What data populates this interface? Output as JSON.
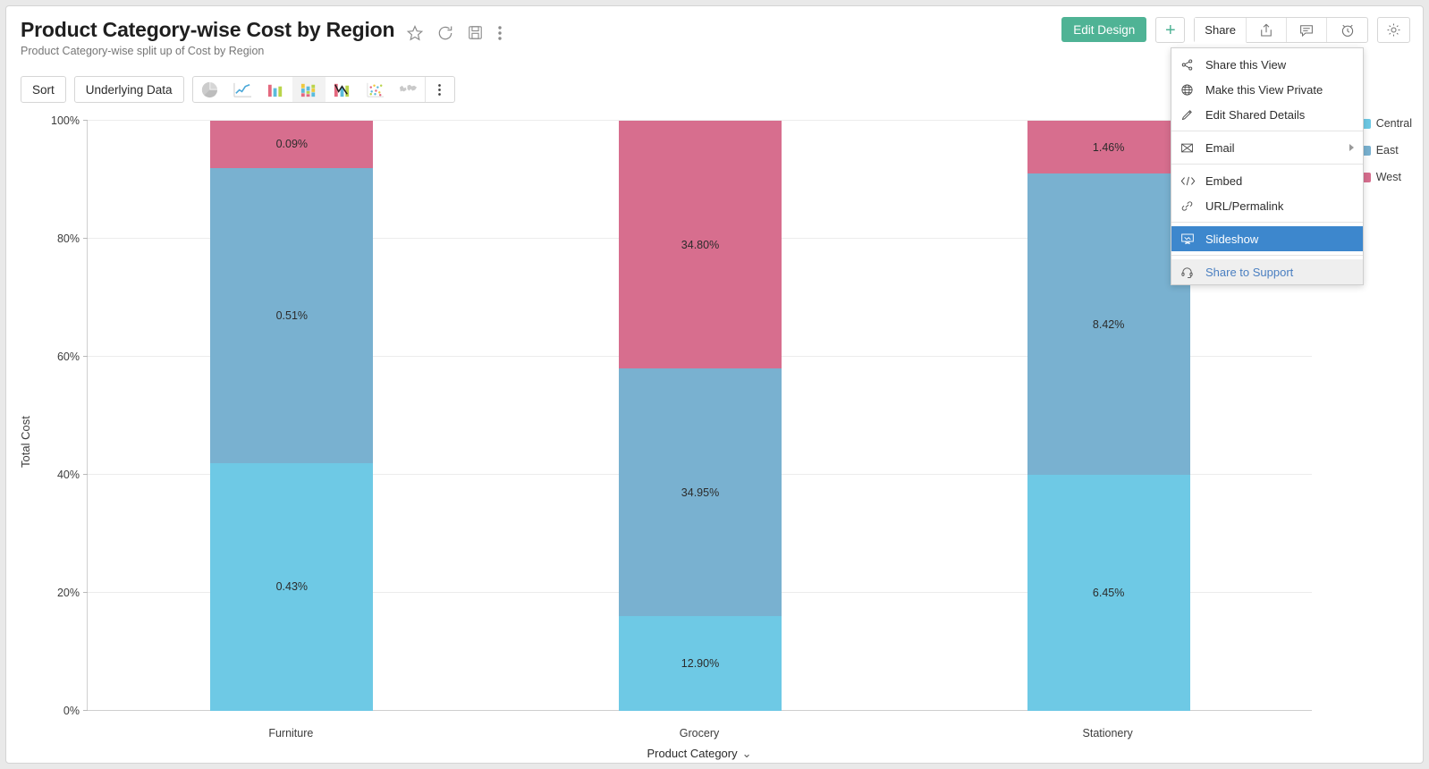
{
  "header": {
    "title": "Product Category-wise Cost by Region",
    "subtitle": "Product Category-wise split up of Cost by Region",
    "icons": [
      "favorite-star-icon",
      "refresh-icon",
      "save-icon",
      "more-options-icon"
    ]
  },
  "actions": {
    "edit_design_label": "Edit Design",
    "add_label": "+",
    "share_tab_label": "Share",
    "export_icon": "export-icon",
    "comment_icon": "comment-icon",
    "alarm_icon": "alarm-clock-icon",
    "settings_icon": "gear-icon",
    "accent_green": "#4fb395"
  },
  "share_menu": {
    "items": [
      {
        "label": "Share this View",
        "icon": "share-nodes-icon",
        "state": "normal"
      },
      {
        "label": "Make this View Private",
        "icon": "globe-icon",
        "state": "normal"
      },
      {
        "label": "Edit Shared Details",
        "icon": "pencil-icon",
        "state": "normal"
      },
      {
        "label": "Email",
        "icon": "envelope-icon",
        "state": "normal",
        "submenu": true
      },
      {
        "label": "Embed",
        "icon": "code-icon",
        "state": "normal"
      },
      {
        "label": "URL/Permalink",
        "icon": "link-icon",
        "state": "normal"
      },
      {
        "label": "Slideshow",
        "icon": "slideshow-icon",
        "state": "selected"
      },
      {
        "label": "Share to Support",
        "icon": "headset-icon",
        "state": "support"
      }
    ],
    "highlight_color": "#3d87cd"
  },
  "toolbar": {
    "sort_label": "Sort",
    "underlying_data_label": "Underlying Data",
    "chart_types": [
      {
        "name": "pie-chart-icon",
        "active": false,
        "disabled": true
      },
      {
        "name": "line-chart-icon",
        "active": false,
        "disabled": false
      },
      {
        "name": "bar-chart-icon",
        "active": false,
        "disabled": false
      },
      {
        "name": "stacked-bar-chart-icon",
        "active": true,
        "disabled": false
      },
      {
        "name": "combo-chart-icon",
        "active": false,
        "disabled": false
      },
      {
        "name": "scatter-chart-icon",
        "active": false,
        "disabled": false
      },
      {
        "name": "map-chart-icon",
        "active": false,
        "disabled": true
      }
    ],
    "more_label": "more-chart-types-icon"
  },
  "chart_data": {
    "type": "bar",
    "stacked": true,
    "normalized": true,
    "title": "Product Category-wise Cost by Region",
    "xlabel": "Product Category",
    "ylabel": "Total Cost",
    "categories": [
      "Furniture",
      "Grocery",
      "Stationery"
    ],
    "ylim": [
      0,
      100
    ],
    "yticks": [
      "0%",
      "20%",
      "40%",
      "60%",
      "80%",
      "100%"
    ],
    "grid": true,
    "legend_position": "right",
    "series": [
      {
        "name": "Central",
        "color": "#6ec9e5",
        "values": [
          0.43,
          12.9,
          6.45
        ],
        "labels": [
          "0.43%",
          "12.90%",
          "6.45%"
        ],
        "pct_of_bar": [
          42.0,
          16.0,
          40.0
        ]
      },
      {
        "name": "East",
        "color": "#79b1d0",
        "values": [
          0.51,
          34.95,
          8.42
        ],
        "labels": [
          "0.51%",
          "34.95%",
          "8.42%"
        ],
        "pct_of_bar": [
          50.0,
          42.0,
          51.0
        ]
      },
      {
        "name": "West",
        "color": "#d76e8e",
        "values": [
          0.09,
          34.8,
          1.46
        ],
        "labels": [
          "0.09%",
          "34.80%",
          "1.46%"
        ],
        "pct_of_bar": [
          8.0,
          42.0,
          9.0
        ]
      }
    ],
    "legend_labels_visible": [
      "Central",
      "East",
      "West"
    ]
  }
}
